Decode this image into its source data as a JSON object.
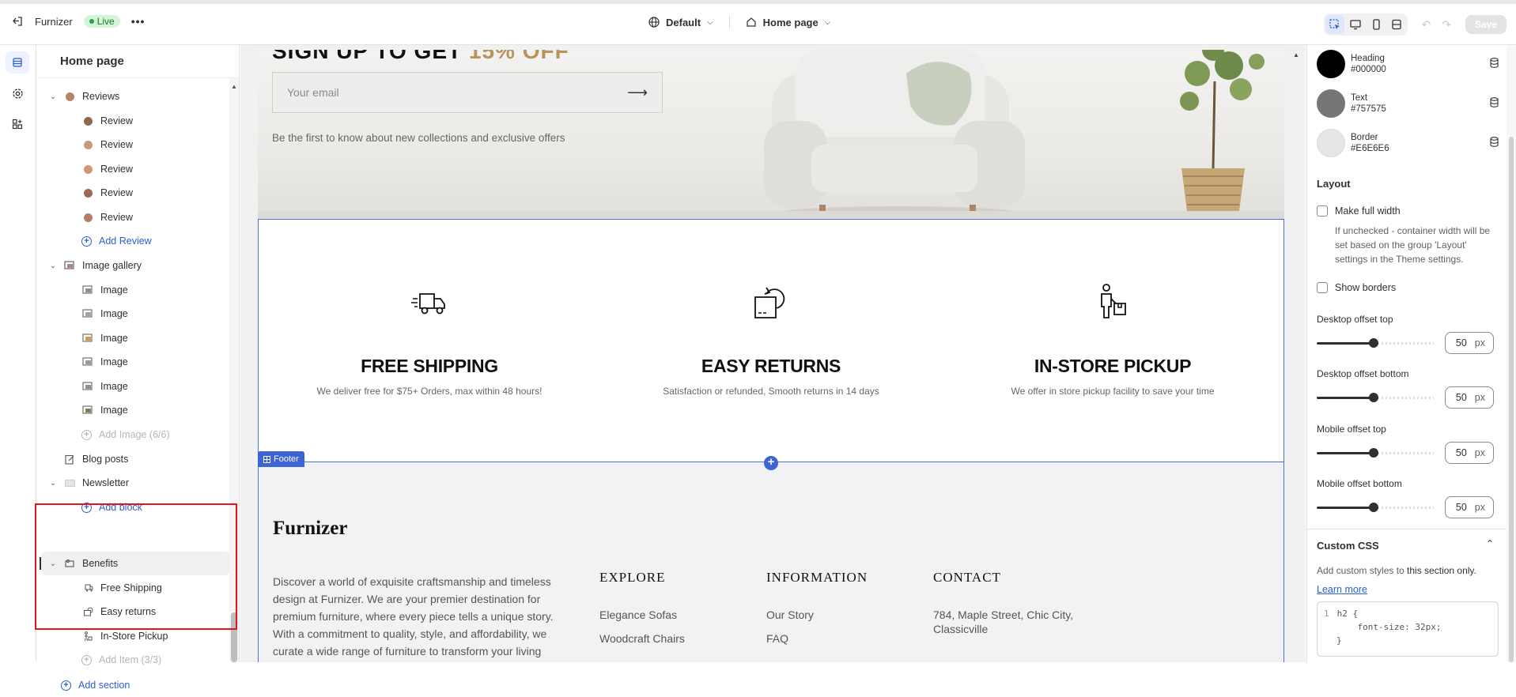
{
  "topbar": {
    "store_name": "Furnizer",
    "status_badge": "Live",
    "theme_selector": "Default",
    "page_selector": "Home page",
    "save_label": "Save"
  },
  "sidebar": {
    "title": "Home page",
    "reviews": {
      "label": "Reviews",
      "items": [
        "Review",
        "Review",
        "Review",
        "Review",
        "Review"
      ],
      "add_label": "Add Review"
    },
    "gallery": {
      "label": "Image gallery",
      "items": [
        "Image",
        "Image",
        "Image",
        "Image",
        "Image",
        "Image"
      ],
      "add_label": "Add Image (6/6)"
    },
    "blog_posts": "Blog posts",
    "newsletter": {
      "label": "Newsletter",
      "add_label": "Add block"
    },
    "benefits": {
      "label": "Benefits",
      "items": [
        "Free Shipping",
        "Easy returns",
        "In-Store Pickup"
      ],
      "add_label": "Add Item (3/3)"
    },
    "add_section": "Add section"
  },
  "canvas": {
    "newsletter": {
      "email_placeholder": "Your email",
      "subtitle": "Be the first to know about new collections and exclusive offers"
    },
    "benefits": [
      {
        "icon": "delivery-truck-icon",
        "heading": "FREE SHIPPING",
        "text": "We deliver free for $75+ Orders, max within 48 hours!"
      },
      {
        "icon": "return-box-icon",
        "heading": "EASY RETURNS",
        "text": "Satisfaction or refunded, Smooth returns in 14 days"
      },
      {
        "icon": "store-pickup-icon",
        "heading": "IN-STORE PICKUP",
        "text": "We offer in store pickup facility to save your time"
      }
    ],
    "footer_tag": "Footer",
    "footer": {
      "logo": "Furnizer",
      "description": "Discover a world of exquisite craftsmanship and timeless design at Furnizer. We are your premier destination for premium furniture, where every piece tells a unique story. With a commitment to quality, style, and affordability, we curate a wide range of furniture to transform your living spaces into a haven of comfort and elegance.",
      "columns": [
        {
          "heading": "EXPLORE",
          "links": [
            "Elegance Sofas",
            "Woodcraft Chairs"
          ]
        },
        {
          "heading": "INFORMATION",
          "links": [
            "Our Story",
            "FAQ"
          ]
        },
        {
          "heading": "CONTACT",
          "links": [
            "784, Maple Street, Chic City, Classicville"
          ]
        }
      ]
    }
  },
  "settings": {
    "colors": [
      {
        "label": "Heading",
        "value": "#000000",
        "swatch": "#000000"
      },
      {
        "label": "Text",
        "value": "#757575",
        "swatch": "#757575"
      },
      {
        "label": "Border",
        "value": "#E6E6E6",
        "swatch": "#E6E6E6"
      }
    ],
    "layout_heading": "Layout",
    "full_width_label": "Make full width",
    "full_width_help": "If unchecked - container width will be set based on the group 'Layout' settings in the Theme settings.",
    "show_borders_label": "Show borders",
    "offsets": [
      {
        "label": "Desktop offset top",
        "value": "50",
        "unit": "px",
        "fraction": 0.5
      },
      {
        "label": "Desktop offset bottom",
        "value": "50",
        "unit": "px",
        "fraction": 0.5
      },
      {
        "label": "Mobile offset top",
        "value": "50",
        "unit": "px",
        "fraction": 0.5
      },
      {
        "label": "Mobile offset bottom",
        "value": "50",
        "unit": "px",
        "fraction": 0.5
      }
    ],
    "custom_css_heading": "Custom CSS",
    "custom_css_help_prefix": "Add custom styles to ",
    "custom_css_help_bold": "this section only.",
    "learn_more": "Learn more",
    "code_line_number": "1",
    "code_lines": [
      "h2 {",
      "    font-size: 32px;",
      "}"
    ]
  }
}
